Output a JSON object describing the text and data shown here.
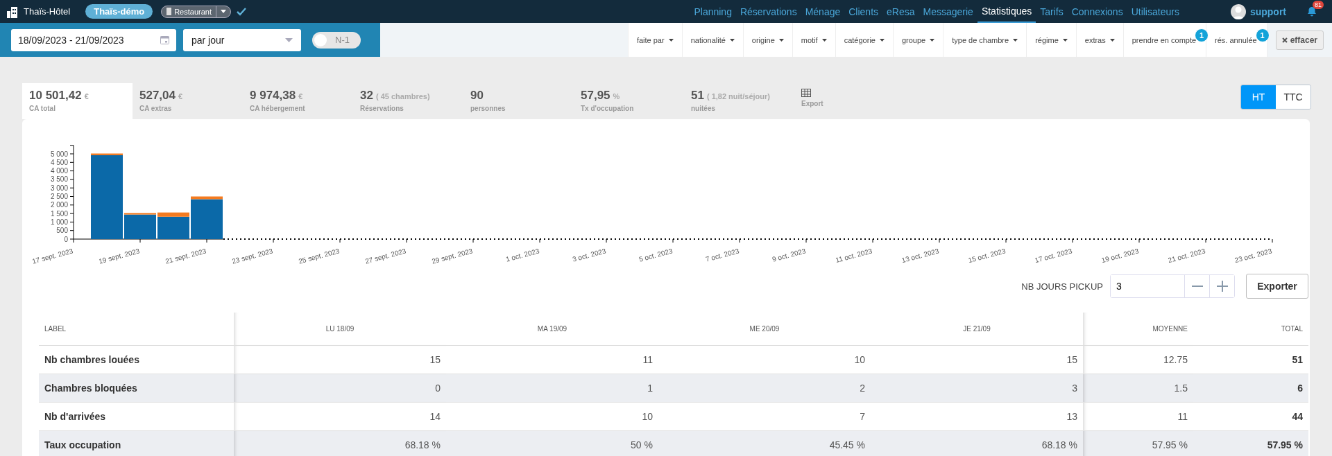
{
  "header": {
    "app_name": "Thaïs-Hôtel",
    "account": "Thaïs-démo",
    "module": "Restaurant",
    "nav": [
      {
        "label": "Planning",
        "selected": false
      },
      {
        "label": "Réservations",
        "selected": false
      },
      {
        "label": "Ménage",
        "selected": false
      },
      {
        "label": "Clients",
        "selected": false
      },
      {
        "label": "eResa",
        "selected": false
      },
      {
        "label": "Messagerie",
        "selected": false
      },
      {
        "label": "Statistiques",
        "selected": true
      },
      {
        "label": "Tarifs",
        "selected": false
      },
      {
        "label": "Connexions",
        "selected": false
      },
      {
        "label": "Utilisateurs",
        "selected": false
      }
    ],
    "user": "support",
    "notifications": "81"
  },
  "filters": {
    "date_range": "18/09/2023 - 21/09/2023",
    "granularity": "par jour",
    "compare": {
      "label": "N-1",
      "on": false
    },
    "items": [
      {
        "label": "faite par",
        "kind": "dropdown"
      },
      {
        "label": "nationalité",
        "kind": "dropdown"
      },
      {
        "label": "origine",
        "kind": "dropdown"
      },
      {
        "label": "motif",
        "kind": "dropdown"
      },
      {
        "label": "catégorie",
        "kind": "dropdown"
      },
      {
        "label": "groupe",
        "kind": "dropdown"
      },
      {
        "label": "type de chambre",
        "kind": "dropdown"
      },
      {
        "label": "régime",
        "kind": "dropdown"
      },
      {
        "label": "extras",
        "kind": "dropdown"
      },
      {
        "label": "prendre en compte",
        "kind": "counter",
        "count": "1"
      },
      {
        "label": "rés. annulée",
        "kind": "counter",
        "count": "1"
      }
    ],
    "clear": "effacer"
  },
  "kpis": [
    {
      "value": "10 501,42",
      "unit": "€",
      "label": "CA total",
      "selected": true
    },
    {
      "value": "527,04",
      "unit": "€",
      "label": "CA extras",
      "selected": false
    },
    {
      "value": "9 974,38",
      "unit": "€",
      "label": "CA hébergement",
      "selected": false
    },
    {
      "value": "32",
      "unit": "( 45 chambres)",
      "label": "Réservations",
      "selected": false
    },
    {
      "value": "90",
      "label": "personnes",
      "selected": false
    },
    {
      "value": "57,95",
      "unit": "%",
      "label": "Tx d'occupation",
      "selected": false
    },
    {
      "value": "51",
      "unit": "( 1,82 nuit/séjour)",
      "label": "nuitées",
      "selected": false
    }
  ],
  "export_kpi": "Export",
  "tax_toggle": [
    {
      "label": "HT",
      "selected": true
    },
    {
      "label": "TTC",
      "selected": false
    }
  ],
  "chart_data": {
    "type": "bar",
    "stacked": true,
    "categories": [
      "17 sept. 2023",
      null,
      "19 sept. 2023",
      null,
      "21 sept. 2023",
      null,
      "23 sept. 2023",
      null,
      "25 sept. 2023",
      null,
      "27 sept. 2023",
      null,
      "29 sept. 2023",
      null,
      "1 oct. 2023",
      null,
      "3 oct. 2023",
      null,
      "5 oct. 2023",
      null,
      "7 oct. 2023",
      null,
      "9 oct. 2023",
      null,
      "11 oct. 2023",
      null,
      "13 oct. 2023",
      null,
      "15 oct. 2023",
      null,
      "17 oct. 2023",
      null,
      "19 oct. 2023",
      null,
      "21 oct. 2023",
      null,
      "23 oct. 2023"
    ],
    "series": [
      {
        "color": "#0b69a8",
        "values": [
          null,
          4920,
          1440,
          1310,
          2340,
          0,
          0,
          0,
          0,
          0,
          0,
          0,
          0,
          0,
          0,
          0,
          0,
          0,
          0,
          0,
          0,
          0,
          0,
          0,
          0,
          0,
          0,
          0,
          0,
          0,
          0,
          0,
          0,
          0,
          0,
          0,
          0
        ]
      },
      {
        "color": "#f47b20",
        "values": [
          null,
          100,
          90,
          250,
          160,
          0,
          0,
          0,
          0,
          0,
          0,
          0,
          0,
          0,
          0,
          0,
          0,
          0,
          0,
          0,
          0,
          0,
          0,
          0,
          0,
          0,
          0,
          0,
          0,
          0,
          0,
          0,
          0,
          0,
          0,
          0,
          0
        ]
      }
    ],
    "ylim": [
      0,
      5500
    ],
    "yticks": [
      {
        "value": 0,
        "label": "0"
      },
      {
        "value": 500,
        "label": "500"
      },
      {
        "value": 1000,
        "label": "1 000"
      },
      {
        "value": 1500,
        "label": "1 500"
      },
      {
        "value": 2000,
        "label": "2 000"
      },
      {
        "value": 2500,
        "label": "2 500"
      },
      {
        "value": 3000,
        "label": "3 000"
      },
      {
        "value": 3500,
        "label": "3 500"
      },
      {
        "value": 4000,
        "label": "4 000"
      },
      {
        "value": 4500,
        "label": "4 500"
      },
      {
        "value": 5000,
        "label": "5 000"
      }
    ]
  },
  "pickup": {
    "label": "NB JOURS PICKUP",
    "value": "3",
    "export": "Exporter"
  },
  "table": {
    "columns": [
      "LABEL",
      "LU 18/09",
      "MA 19/09",
      "ME 20/09",
      "JE 21/09",
      "MOYENNE",
      "TOTAL"
    ],
    "rows": [
      {
        "label": "Nb chambres louées",
        "values": [
          "15",
          "11",
          "10",
          "15"
        ],
        "average": "12.75",
        "total": "51"
      },
      {
        "label": "Chambres bloquées",
        "values": [
          "0",
          "1",
          "2",
          "3"
        ],
        "average": "1.5",
        "total": "6"
      },
      {
        "label": "Nb d'arrivées",
        "values": [
          "14",
          "10",
          "7",
          "13"
        ],
        "average": "11",
        "total": "44"
      },
      {
        "label": "Taux occupation",
        "values": [
          "68.18 %",
          "50 %",
          "45.45 %",
          "68.18 %"
        ],
        "average": "57.95 %",
        "total": "57.95 %"
      }
    ]
  }
}
